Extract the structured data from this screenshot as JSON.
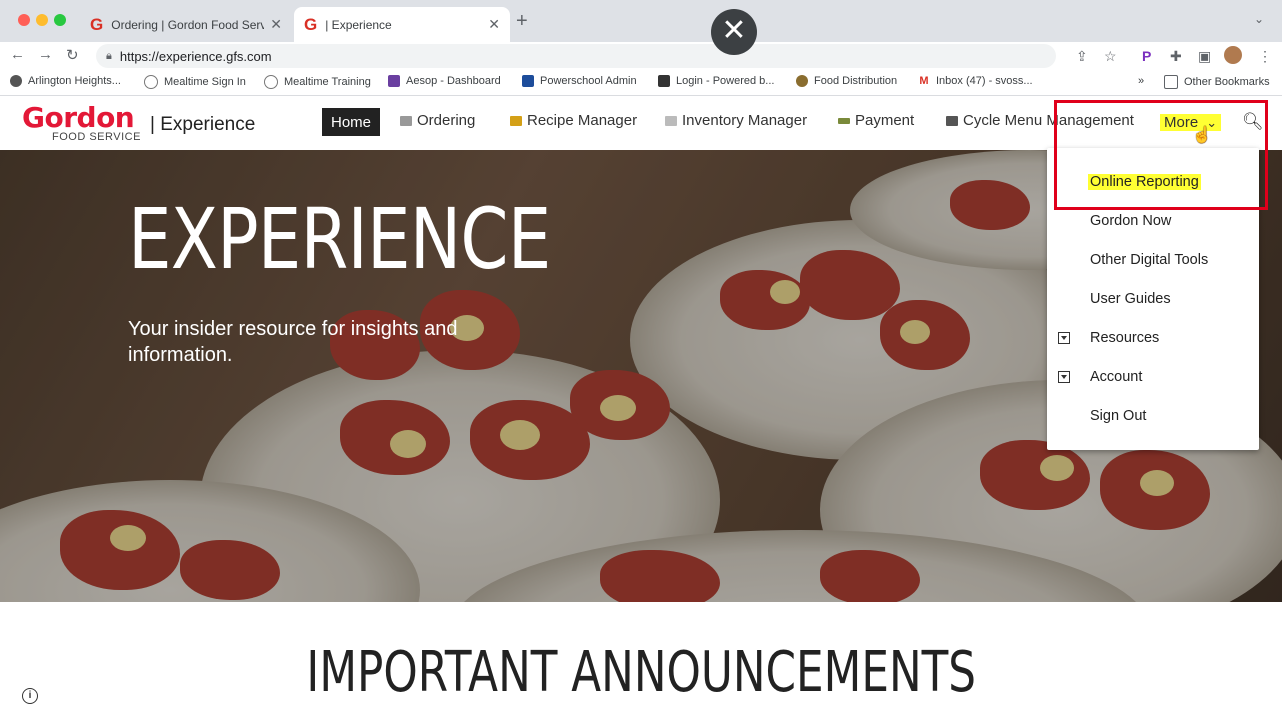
{
  "browser": {
    "tabs": [
      {
        "label": "Ordering | Gordon Food Servic",
        "favicon": "G"
      },
      {
        "label": "| Experience",
        "favicon": "G"
      }
    ],
    "new_tab": "+",
    "tab_close": "✕",
    "url": "https://experience.gfs.com",
    "bookmarks": [
      {
        "label": "Arlington Heights...",
        "color": "#555555"
      },
      {
        "label": "Mealtime Sign In",
        "color": "#777777"
      },
      {
        "label": "Mealtime Training",
        "color": "#777777"
      },
      {
        "label": "Aesop - Dashboard",
        "color": "#6a3fa0"
      },
      {
        "label": "Powerschool Admin",
        "color": "#1d4d9b"
      },
      {
        "label": "Login - Powered b...",
        "color": "#333333"
      },
      {
        "label": "Food Distribution",
        "color": "#8a6d2f"
      },
      {
        "label": "Inbox (47) - svoss...",
        "color": "#d93025"
      },
      {
        "label": "»",
        "color": ""
      },
      {
        "label": "Other Bookmarks",
        "color": ""
      }
    ]
  },
  "site": {
    "logo_name": "Gordon",
    "logo_sub": "FOOD SERVICE",
    "logo_section": "| Experience",
    "nav": [
      {
        "label": "Home"
      },
      {
        "label": "Ordering"
      },
      {
        "label": "Recipe Manager"
      },
      {
        "label": "Inventory Manager"
      },
      {
        "label": "Payment"
      },
      {
        "label": "Cycle Menu Management"
      },
      {
        "label": "More"
      }
    ],
    "more_chevron": "⌄"
  },
  "hero": {
    "title": "EXPERIENCE",
    "subtitle": "Your insider resource for insights and information."
  },
  "dropdown": {
    "items": [
      {
        "label": "Online Reporting"
      },
      {
        "label": "Gordon Now"
      },
      {
        "label": "Other Digital Tools"
      },
      {
        "label": "User Guides"
      },
      {
        "label": "Resources"
      },
      {
        "label": "Account"
      },
      {
        "label": "Sign Out"
      }
    ]
  },
  "announcements": {
    "title": "IMPORTANT ANNOUNCEMENTS"
  },
  "colors": {
    "brand_red": "#e31837",
    "highlight_yellow": "#ffff33",
    "annotation_red": "#e0001b"
  }
}
